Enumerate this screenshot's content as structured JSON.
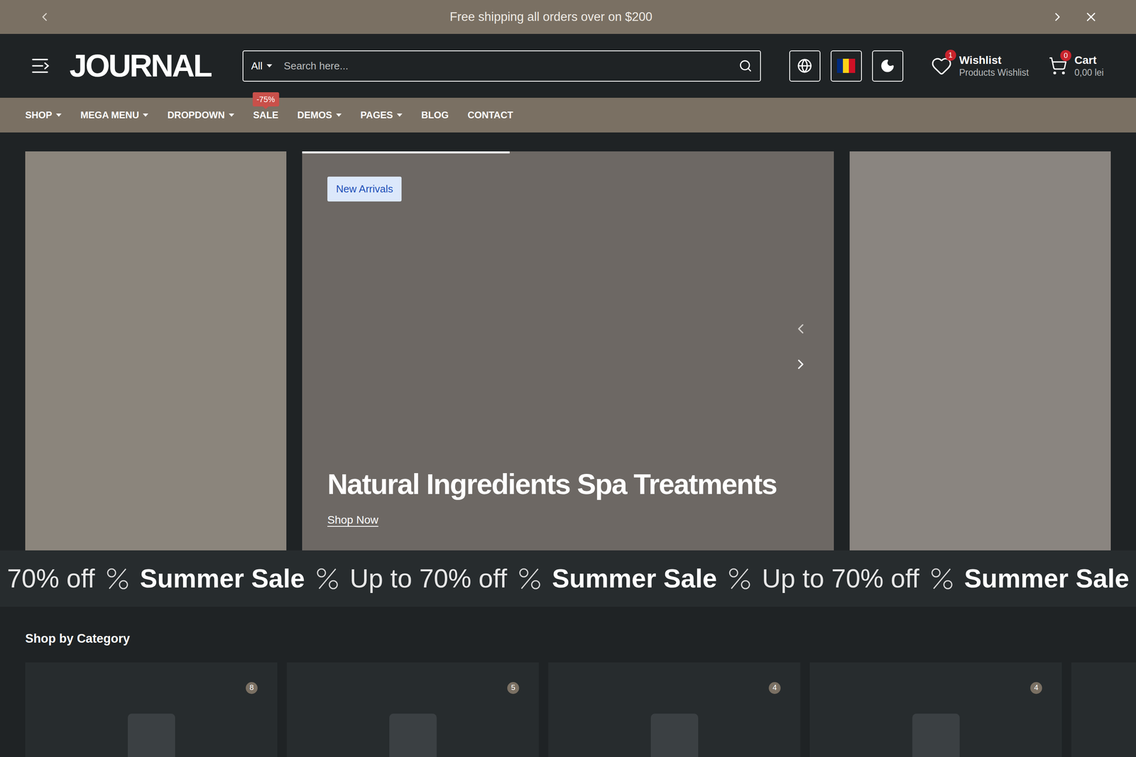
{
  "announcement": {
    "text": "Free shipping all orders over on $200"
  },
  "header": {
    "logo": "JOURNAL",
    "search": {
      "category": "All",
      "placeholder": "Search here..."
    },
    "wishlist": {
      "label": "Wishlist",
      "sublabel": "Products Wishlist",
      "count": "1"
    },
    "cart": {
      "label": "Cart",
      "total": "0,00 lei",
      "count": "0"
    }
  },
  "nav": [
    {
      "label": "SHOP",
      "dropdown": true
    },
    {
      "label": "MEGA MENU",
      "dropdown": true
    },
    {
      "label": "DROPDOWN",
      "dropdown": true
    },
    {
      "label": "SALE",
      "dropdown": false,
      "badge": "-75%"
    },
    {
      "label": "DEMOS",
      "dropdown": true
    },
    {
      "label": "PAGES",
      "dropdown": true
    },
    {
      "label": "BLOG",
      "dropdown": false
    },
    {
      "label": "CONTACT",
      "dropdown": false
    }
  ],
  "hero": {
    "badge": "New Arrivals",
    "title": "Natural Ingredients Spa Treatments",
    "link": "Shop Now",
    "progress": 0.39
  },
  "marquee": [
    {
      "text": "70% off",
      "bold": false
    },
    {
      "text": "Summer Sale",
      "bold": true
    },
    {
      "text": "Up to 70% off",
      "bold": false
    },
    {
      "text": "Summer Sale",
      "bold": true
    },
    {
      "text": "Up to 70% off",
      "bold": false
    },
    {
      "text": "Summer Sale",
      "bold": true
    }
  ],
  "categories": {
    "title": "Shop by Category",
    "items": [
      {
        "count": "8"
      },
      {
        "count": "5"
      },
      {
        "count": "4"
      },
      {
        "count": "4"
      },
      {}
    ]
  }
}
